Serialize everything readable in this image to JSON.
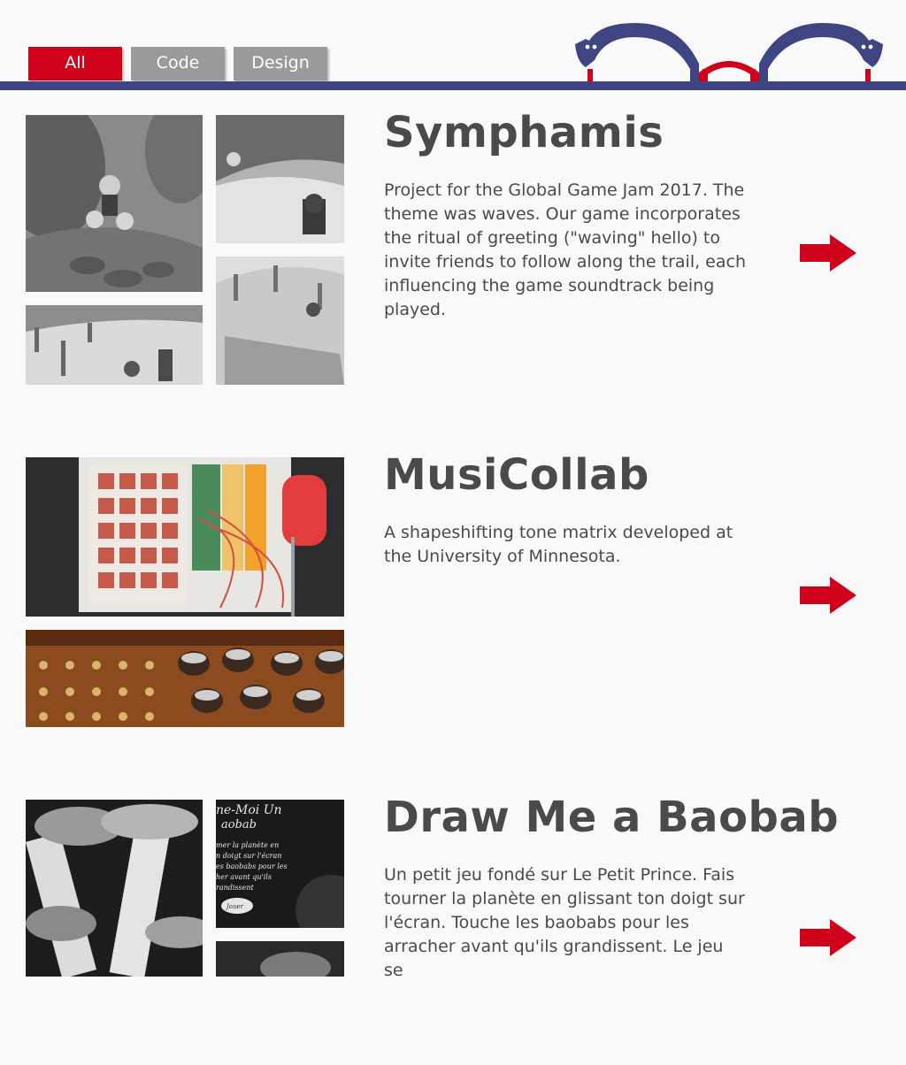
{
  "filters": {
    "all": "All",
    "code": "Code",
    "design": "Design",
    "active": "All"
  },
  "colors": {
    "accent": "#d0021b",
    "nav": "#3f4483",
    "tab_inactive": "#9a9a9a",
    "text": "#4a4a4a"
  },
  "projects": [
    {
      "title": "Symphamis",
      "description": "Project for the Global Game Jam 2017. The theme was waves. Our game incorporates the ritual of greeting (\"waving\" hello) to invite friends to follow along the trail, each influencing the game soundtrack being played."
    },
    {
      "title": "MusiCollab",
      "description": "A shapeshifting tone matrix developed at the University of Minnesota."
    },
    {
      "title": "Draw Me a Baobab",
      "description": "Un petit jeu fondé sur Le Petit Prince. Fais tourner la planète en glissant ton doigt sur l'écran. Touche les baobabs pour les arracher avant qu'ils grandissent. Le jeu se",
      "screenshot_text": [
        "ne-Moi Un",
        "aobab",
        "mer la planète en",
        "n doigt sur l'écran",
        "es baobabs pour les",
        "her avant qu'ils",
        "randissent",
        "Jouer"
      ]
    }
  ],
  "icons": {
    "logo": "glasses-icon",
    "more": "arrow-right-icon"
  }
}
